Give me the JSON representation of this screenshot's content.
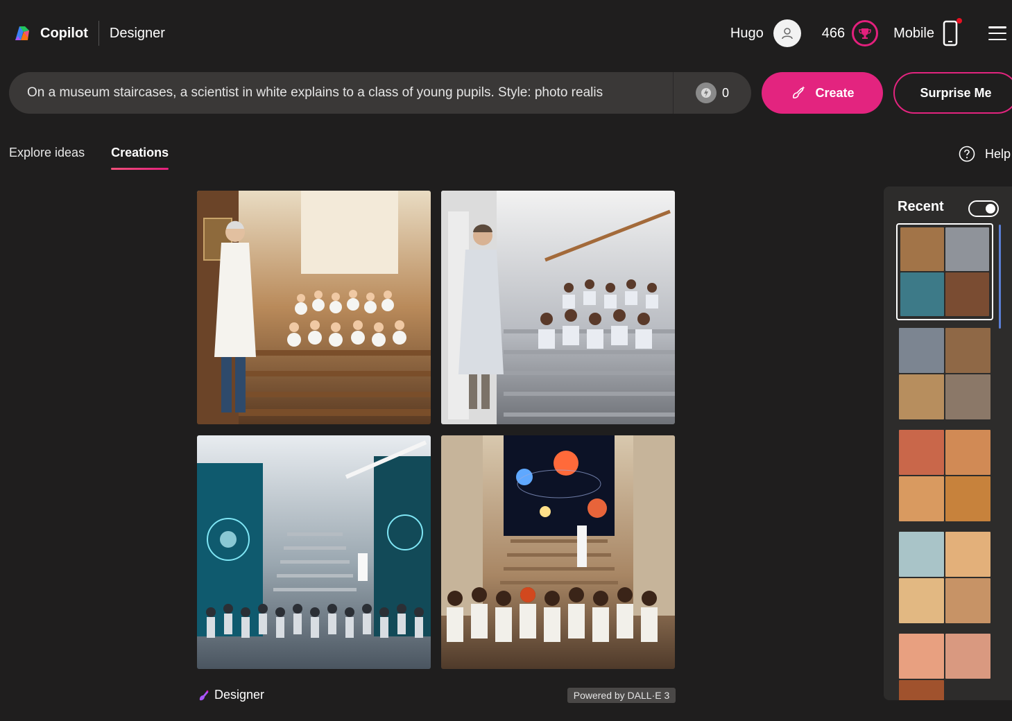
{
  "header": {
    "brand_name": "Copilot",
    "product_name": "Designer",
    "user_name": "Hugo",
    "points": "466",
    "mobile_label": "Mobile"
  },
  "prompt": {
    "value": "On a museum staircases, a scientist in white explains to a class of young pupils. Style: photo realis",
    "boosts": "0"
  },
  "actions": {
    "create_label": "Create",
    "surprise_label": "Surprise Me"
  },
  "tabs": [
    {
      "label": "Explore ideas",
      "active": false
    },
    {
      "label": "Creations",
      "active": true
    }
  ],
  "help_label": "Help",
  "footer": {
    "brand": "Designer",
    "powered_by": "Powered by DALL·E 3"
  },
  "recent": {
    "title": "Recent",
    "toggle_on": true
  },
  "colors": {
    "accent": "#e3247f",
    "background": "#1f1e1e",
    "panel": "#2d2c2b"
  }
}
